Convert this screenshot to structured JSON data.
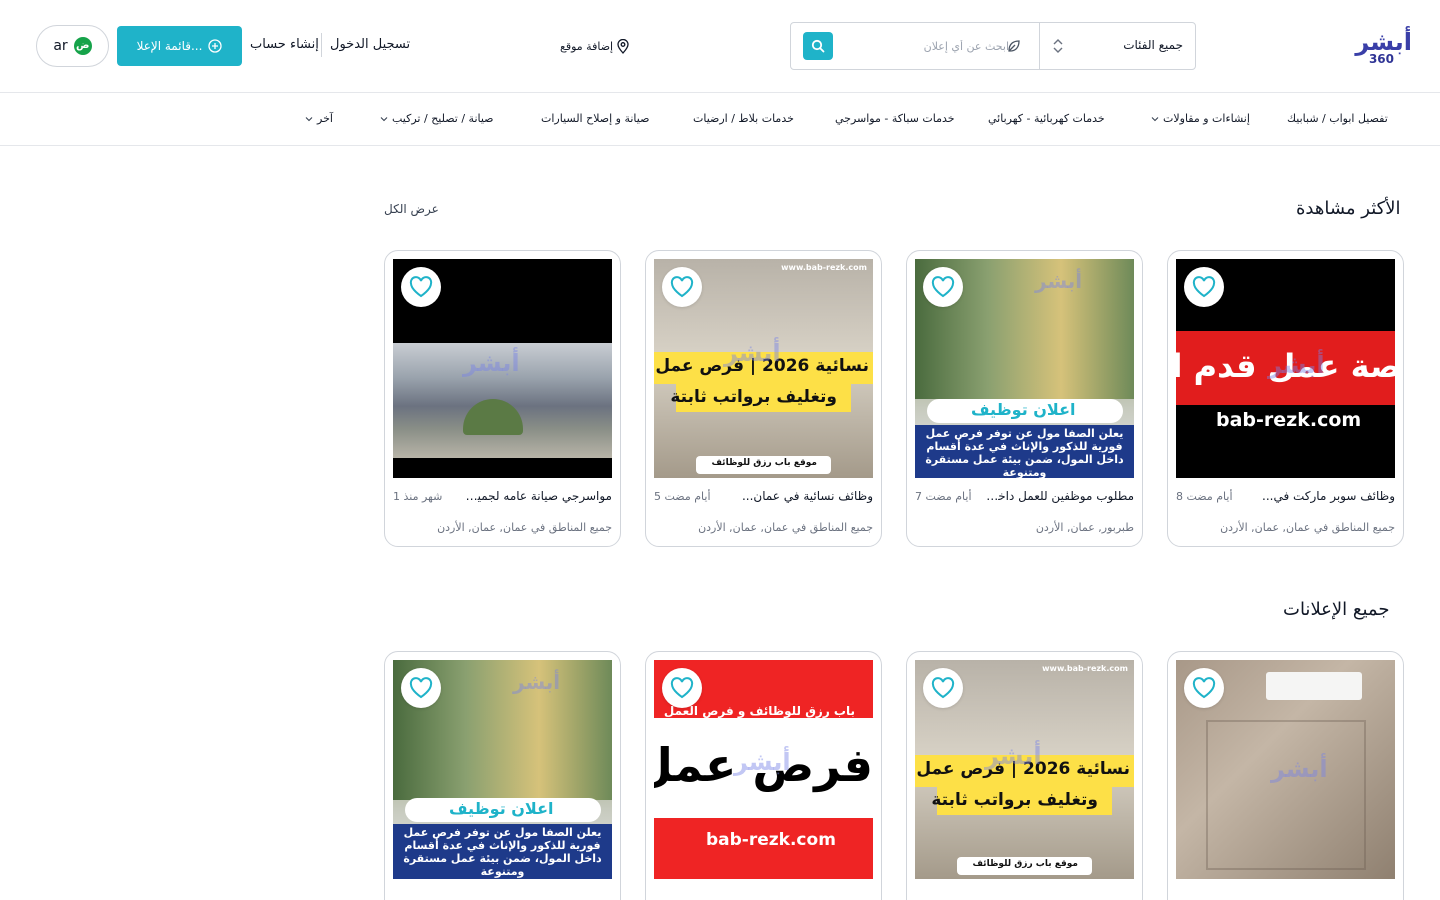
{
  "brand": {
    "logo_word": "أبشر",
    "logo_num": "360",
    "primary_color": "#1fb3c9"
  },
  "search": {
    "category_label": "جميع الفئات",
    "placeholder": "ابحث عن أي إعلان"
  },
  "header": {
    "add_location": "إضافة موقع",
    "login": "تسجيل الدخول",
    "register": "إنشاء حساب",
    "post_button": "قائمة الإعلا...",
    "lang_badge": "ض",
    "lang_code": "ar"
  },
  "nav": [
    {
      "label": "تفصيل ابواب / شبابيك"
    },
    {
      "label": "إنشاءات و مقاولات"
    },
    {
      "label": "خدمات كهربائية - كهربائي"
    },
    {
      "label": "خدمات سباكة - مواسرجي"
    },
    {
      "label": "خدمات بلاط / ارضيات"
    },
    {
      "label": "صيانة و إصلاح السيارات"
    },
    {
      "label": "صيانة / تصليح / تركيب"
    },
    {
      "label": "آخر"
    }
  ],
  "most_viewed": {
    "title": "الأكثر مشاهدة",
    "view_all": "عرض الكل",
    "cards": [
      {
        "title": "وظائف سوبر ماركت في...",
        "time": "8 أيام مضت",
        "location": "جميع المناطق في عمان, عمان, الأردن",
        "img_line1": "صة عمل قدم ا",
        "img_line2": "bab-rezk.com"
      },
      {
        "title": "مطلوب موظفين للعمل داخل...",
        "time": "7 أيام مضت",
        "location": "طبربور, عمان, الأردن",
        "img_head": "اعلان توظيف",
        "img_body": "يعلن الصفا مول عن توفر فرص عمل فورية للذكور والإناث في عدة أقسام داخل المول، ضمن بيئة عمل مستقرة ومتنوعة"
      },
      {
        "title": "وظائف نسائية في عمان...",
        "time": "5 أيام مضت",
        "location": "جميع المناطق في عمان, عمان, الأردن",
        "img_line1": "نسائية 2026 | فرص عمل",
        "img_line2": "وتغليف برواتب ثابتة",
        "img_caption": "موقع باب رزق للوظائف",
        "img_site": "www.bab-rezk.com"
      },
      {
        "title": "مواسرجي صيانة عامه لجميع...",
        "time": "1 شهر منذ",
        "location": "جميع المناطق في عمان, عمان, الأردن"
      }
    ]
  },
  "all_ads": {
    "title": "جميع الإعلانات",
    "cards": [
      {
        "img_kind": "wall"
      },
      {
        "img_line1": "نسائية 2026 | فرص عمل",
        "img_line2": "وتغليف برواتب ثابتة",
        "img_caption": "موقع باب رزق للوظائف",
        "img_site": "www.bab-rezk.com"
      },
      {
        "img_top": "باب رزق للوظائف و فرص العمل",
        "img_big": "فرص عمل",
        "img_site": "bab-rezk.com"
      },
      {
        "img_head": "اعلان توظيف",
        "img_body": "يعلن الصفا مول عن توفر فرص عمل فورية للذكور والإناث في عدة أقسام داخل المول، ضمن بيئة عمل مستقرة ومتنوعة"
      }
    ]
  }
}
